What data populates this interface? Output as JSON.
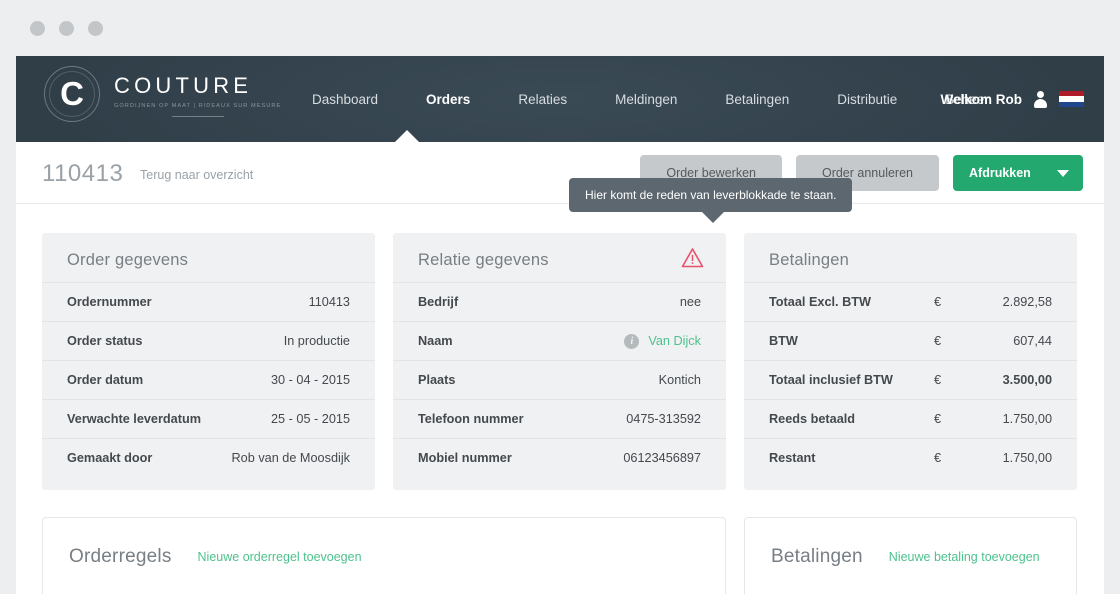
{
  "window": {
    "dots": [
      "close-dot",
      "minimize-dot",
      "maximize-dot"
    ]
  },
  "header": {
    "brand": {
      "mark_letter": "C",
      "name": "COUTURE",
      "tagline": "GORDIJNEN OP MAAT  |  RIDEAUX SUR MESURE"
    },
    "nav": [
      {
        "label": "Dashboard",
        "active": false
      },
      {
        "label": "Orders",
        "active": true
      },
      {
        "label": "Relaties",
        "active": false
      },
      {
        "label": "Meldingen",
        "active": false
      },
      {
        "label": "Betalingen",
        "active": false
      },
      {
        "label": "Distributie",
        "active": false
      },
      {
        "label": "Beheer",
        "active": false
      }
    ],
    "user": {
      "welcome": "Welkom Rob",
      "avatar_icon": "user-icon",
      "language_flag": "nl-flag"
    }
  },
  "subheader": {
    "order_number": "110413",
    "back_link": "Terug naar overzicht",
    "buttons": {
      "edit": "Order bewerken",
      "cancel": "Order annuleren",
      "print": "Afdrukken"
    }
  },
  "tooltip": {
    "text": "Hier komt de reden van leverblokkade te staan."
  },
  "cards": {
    "order": {
      "title": "Order gegevens",
      "rows": [
        {
          "key": "Ordernummer",
          "value": "110413"
        },
        {
          "key": "Order status",
          "value": "In productie"
        },
        {
          "key": "Order datum",
          "value": "30 - 04 - 2015"
        },
        {
          "key": "Verwachte leverdatum",
          "value": "25 - 05 - 2015"
        },
        {
          "key": "Gemaakt door",
          "value": "Rob van de Moosdijk"
        }
      ]
    },
    "relation": {
      "title": "Relatie gegevens",
      "warning_icon": "warning-triangle-icon",
      "rows": [
        {
          "key": "Bedrijf",
          "value": "nee"
        },
        {
          "key": "Naam",
          "value": "Van Dijck",
          "icon": "info-icon",
          "link": true
        },
        {
          "key": "Plaats",
          "value": "Kontich"
        },
        {
          "key": "Telefoon nummer",
          "value": "0475-313592"
        },
        {
          "key": "Mobiel nummer",
          "value": "06123456897"
        }
      ]
    },
    "payments": {
      "title": "Betalingen",
      "currency": "€",
      "rows": [
        {
          "key": "Totaal Excl. BTW",
          "currency": "€",
          "value": "2.892,58",
          "bold": false
        },
        {
          "key": "BTW",
          "currency": "€",
          "value": "607,44",
          "bold": false
        },
        {
          "key": "Totaal inclusief BTW",
          "currency": "€",
          "value": "3.500,00",
          "bold": true
        },
        {
          "key": "Reeds betaald",
          "currency": "€",
          "value": "1.750,00",
          "bold": false
        },
        {
          "key": "Restant",
          "currency": "€",
          "value": "1.750,00",
          "bold": false
        }
      ]
    }
  },
  "panels": {
    "orderlines": {
      "title": "Orderregels",
      "add_link": "Nieuwe orderregel toevoegen"
    },
    "payments": {
      "title": "Betalingen",
      "add_link": "Nieuwe betaling toevoegen"
    }
  },
  "colors": {
    "header_bg": "#303e48",
    "accent_green": "#23a96f",
    "link_green": "#4ec28d",
    "card_bg": "#f0f1f2",
    "tooltip_bg": "#5d676f",
    "warning_red": "#e8516d"
  }
}
